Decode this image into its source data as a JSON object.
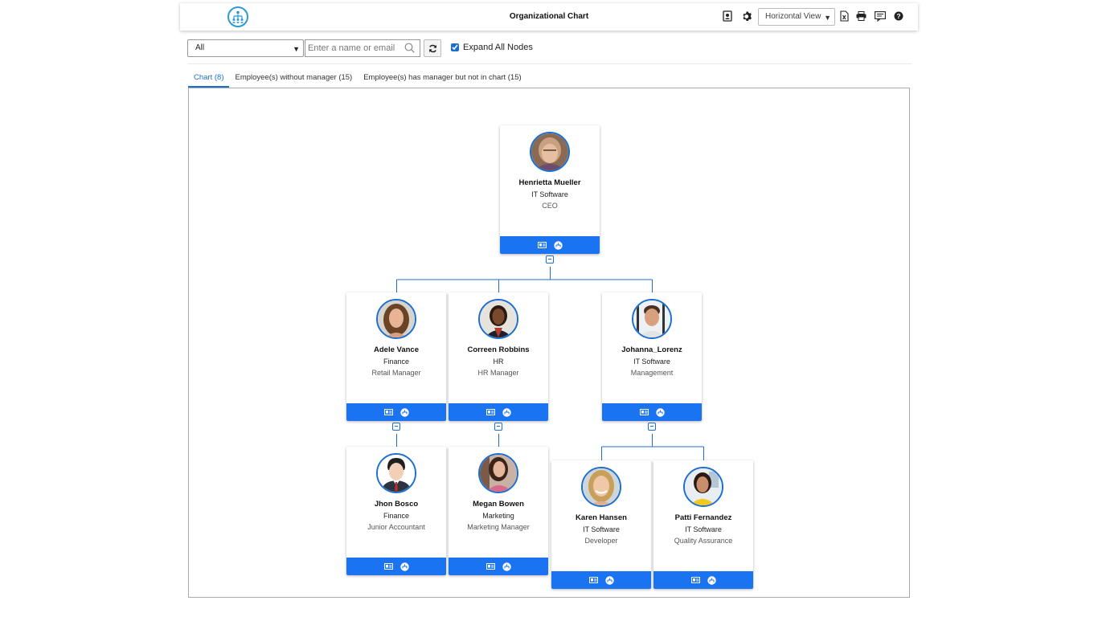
{
  "header": {
    "title": "Organizational Chart",
    "view_selected": "Horizontal View",
    "icons": [
      "contact-card-icon",
      "gear-icon",
      "excel-export-icon",
      "print-icon",
      "feedback-icon",
      "help-icon"
    ]
  },
  "toolbar": {
    "filter_selected": "All",
    "search_placeholder": "Enter a name or email",
    "expand_label": "Expand All Nodes",
    "expand_checked": true
  },
  "tabs": [
    {
      "label": "Chart (8)",
      "active": true
    },
    {
      "label": "Employee(s) without manager (15)",
      "active": false
    },
    {
      "label": "Employee(s) has manager but not in chart (15)",
      "active": false
    }
  ],
  "colors": {
    "accent": "#1a73f0",
    "link": "#1a6fd1",
    "logo": "#2b9bd1"
  },
  "employees": [
    {
      "name": "Henrietta Mueller",
      "dept": "IT Software",
      "title": "CEO"
    },
    {
      "name": "Adele Vance",
      "dept": "Finance",
      "title": "Retail Manager"
    },
    {
      "name": "Correen Robbins",
      "dept": "HR",
      "title": "HR Manager"
    },
    {
      "name": "Johanna_Lorenz",
      "dept": "IT Software",
      "title": "Management"
    },
    {
      "name": "Jhon Bosco",
      "dept": "Finance",
      "title": "Junior Accountant"
    },
    {
      "name": "Megan Bowen",
      "dept": "Marketing",
      "title": "Marketing Manager"
    },
    {
      "name": "Karen Hansen",
      "dept": "IT Software",
      "title": "Developer"
    },
    {
      "name": "Patti Fernandez",
      "dept": "IT Software",
      "title": "Quality Assurance"
    }
  ]
}
